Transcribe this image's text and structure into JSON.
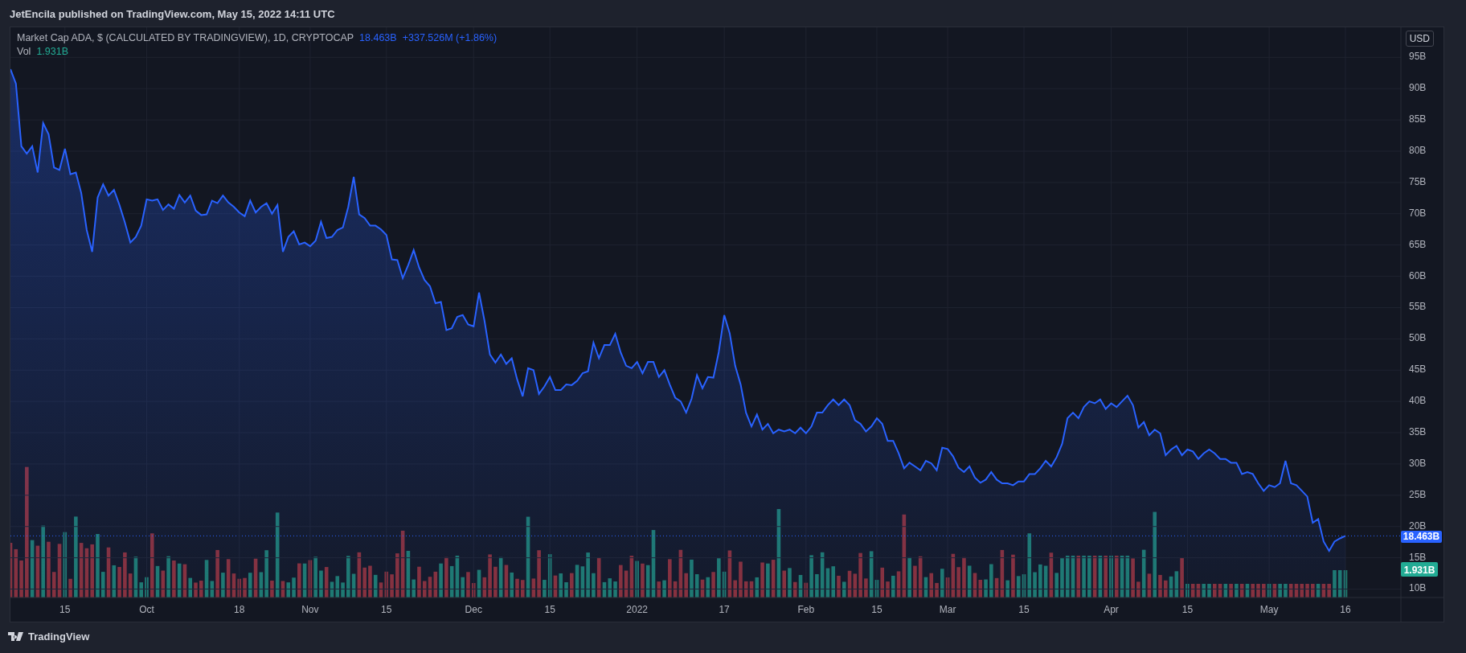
{
  "header": {
    "text": "JetEncila published on TradingView.com, May 15, 2022 14:11 UTC"
  },
  "legend": {
    "symbol": "Market Cap ADA, $ (CALCULATED BY TRADINGVIEW), 1D, CRYPTOCAP",
    "value": "18.463B",
    "change": "+337.526M (+1.86%)",
    "volume_name": "Vol",
    "volume_value": "1.931B"
  },
  "chart": {
    "currency_button": "USD",
    "price_label": "18.463B",
    "volume_label": "1.931B",
    "chart_data": {
      "type": "area",
      "grid": true,
      "ylim": [
        8.65,
        99.8
      ],
      "categories": [
        null,
        null,
        null,
        null,
        null,
        null,
        null,
        null,
        null,
        null,
        "15",
        null,
        null,
        null,
        null,
        null,
        null,
        null,
        null,
        null,
        null,
        null,
        null,
        null,
        null,
        "Oct",
        null,
        null,
        null,
        null,
        null,
        null,
        null,
        null,
        null,
        null,
        null,
        null,
        null,
        null,
        null,
        null,
        "18",
        null,
        null,
        null,
        null,
        null,
        null,
        null,
        null,
        null,
        null,
        null,
        null,
        "Nov",
        null,
        null,
        null,
        null,
        null,
        null,
        null,
        null,
        null,
        null,
        null,
        null,
        null,
        "15",
        null,
        null,
        null,
        null,
        null,
        null,
        null,
        null,
        null,
        null,
        null,
        null,
        null,
        null,
        null,
        "Dec",
        null,
        null,
        null,
        null,
        null,
        null,
        null,
        null,
        null,
        null,
        null,
        null,
        null,
        "15",
        null,
        null,
        null,
        null,
        null,
        null,
        null,
        null,
        null,
        null,
        null,
        null,
        null,
        null,
        null,
        "2022",
        null,
        null,
        null,
        null,
        null,
        null,
        null,
        null,
        null,
        null,
        null,
        null,
        null,
        null,
        null,
        "17",
        null,
        null,
        null,
        null,
        null,
        null,
        null,
        null,
        null,
        null,
        null,
        null,
        null,
        null,
        "Feb",
        null,
        null,
        null,
        null,
        null,
        null,
        null,
        null,
        null,
        null,
        null,
        null,
        "15",
        null,
        null,
        null,
        null,
        null,
        null,
        null,
        null,
        null,
        null,
        null,
        null,
        "Mar",
        null,
        null,
        null,
        null,
        null,
        null,
        null,
        null,
        null,
        null,
        null,
        null,
        null,
        "15",
        null,
        null,
        null,
        null,
        null,
        null,
        null,
        null,
        null,
        null,
        null,
        null,
        null,
        null,
        null,
        "Apr",
        null,
        null,
        null,
        null,
        null,
        null,
        null,
        null,
        null,
        null,
        null,
        null,
        null,
        "15",
        null,
        null,
        null,
        null,
        null,
        null,
        null,
        null,
        null,
        null,
        null,
        null,
        null,
        null,
        "May",
        null,
        null,
        null,
        null,
        null,
        null,
        null,
        null,
        null,
        null,
        null,
        null,
        null,
        "16"
      ],
      "yticks": [
        {
          "value": 10,
          "label": "10B"
        },
        {
          "value": 15,
          "label": "15B"
        },
        {
          "value": 20,
          "label": "20B"
        },
        {
          "value": 25,
          "label": "25B"
        },
        {
          "value": 30,
          "label": "30B"
        },
        {
          "value": 35,
          "label": "35B"
        },
        {
          "value": 40,
          "label": "40B"
        },
        {
          "value": 45,
          "label": "45B"
        },
        {
          "value": 50,
          "label": "50B"
        },
        {
          "value": 55,
          "label": "55B"
        },
        {
          "value": 60,
          "label": "60B"
        },
        {
          "value": 65,
          "label": "65B"
        },
        {
          "value": 70,
          "label": "70B"
        },
        {
          "value": 75,
          "label": "75B"
        },
        {
          "value": 80,
          "label": "80B"
        },
        {
          "value": 85,
          "label": "85B"
        },
        {
          "value": 90,
          "label": "90B"
        },
        {
          "value": 95,
          "label": "95B"
        }
      ],
      "series": [
        {
          "color": "#2962ff",
          "values": [
            93.1,
            90.8,
            80.8,
            79.6,
            80.8,
            76.6,
            84.5,
            82.7,
            77.4,
            77,
            80.4,
            76.3,
            76.6,
            73.3,
            67.4,
            63.9,
            72.6,
            74.7,
            72.9,
            73.8,
            71.4,
            68.6,
            65.4,
            66.3,
            68.1,
            72.3,
            72.1,
            72.3,
            70.6,
            71.5,
            70.8,
            73,
            71.8,
            72.9,
            70.5,
            69.8,
            69.9,
            72.1,
            71.7,
            72.9,
            71.8,
            71.1,
            70.2,
            69.6,
            72.1,
            70.2,
            71.1,
            71.7,
            70,
            71.4,
            63.9,
            66.3,
            67.2,
            65.1,
            65.4,
            64.8,
            65.7,
            68.7,
            66.1,
            66.3,
            67.4,
            67.8,
            71.1,
            75.9,
            69.9,
            69.3,
            68.1,
            68.1,
            67.5,
            66.6,
            62.7,
            62.6,
            59.7,
            61.8,
            64.2,
            61.4,
            59.4,
            58.4,
            55.7,
            55.9,
            51.4,
            51.7,
            53.5,
            53.8,
            52.3,
            52,
            57.4,
            52.9,
            47.5,
            46.2,
            47.5,
            46,
            46.9,
            43.5,
            40.8,
            45.3,
            45,
            41.2,
            42.4,
            43.9,
            41.8,
            41.8,
            42.7,
            42.6,
            43.3,
            44.5,
            44.8,
            49.4,
            46.9,
            49,
            49,
            50.8,
            47.8,
            45.7,
            45.3,
            46.3,
            44.5,
            46.3,
            46.3,
            43.9,
            45,
            42.7,
            40.6,
            40,
            38.2,
            40.4,
            44.2,
            42.1,
            43.9,
            43.8,
            47.9,
            53.8,
            50.9,
            45.7,
            42.7,
            38.2,
            36,
            37.9,
            35.5,
            36.4,
            34.9,
            35.5,
            35.2,
            35.5,
            34.9,
            35.8,
            34.9,
            36,
            38.2,
            38.2,
            39.4,
            40.3,
            39.4,
            40.3,
            39.4,
            37,
            36.4,
            35.2,
            36,
            37.3,
            36.4,
            33.7,
            33.7,
            31.7,
            29.3,
            30.2,
            29.6,
            29,
            30.5,
            30.1,
            29,
            32.6,
            32.4,
            31.2,
            29.4,
            28.7,
            29.6,
            27.8,
            27,
            27.5,
            28.7,
            27.5,
            26.9,
            26.9,
            26.6,
            27.2,
            27.2,
            28.4,
            28.4,
            29.3,
            30.5,
            29.6,
            31.1,
            33.2,
            37.3,
            38.2,
            37.3,
            39.1,
            40,
            39.7,
            40.3,
            38.8,
            39.7,
            39.1,
            40,
            40.9,
            39.4,
            35.8,
            36.7,
            34.6,
            35.5,
            34.9,
            31.4,
            32.3,
            32.9,
            31.4,
            32.3,
            32,
            30.8,
            31.7,
            32.3,
            31.7,
            30.8,
            30.8,
            30.2,
            30.2,
            28.4,
            28.7,
            28.4,
            26.9,
            25.7,
            26.6,
            26.3,
            26.9,
            30.5,
            26.9,
            26.6,
            25.7,
            24.8,
            20.6,
            21.2,
            17.6,
            16.1,
            17.6,
            18.1,
            18.5
          ]
        }
      ]
    }
  },
  "footer": {
    "brand": "TradingView"
  }
}
